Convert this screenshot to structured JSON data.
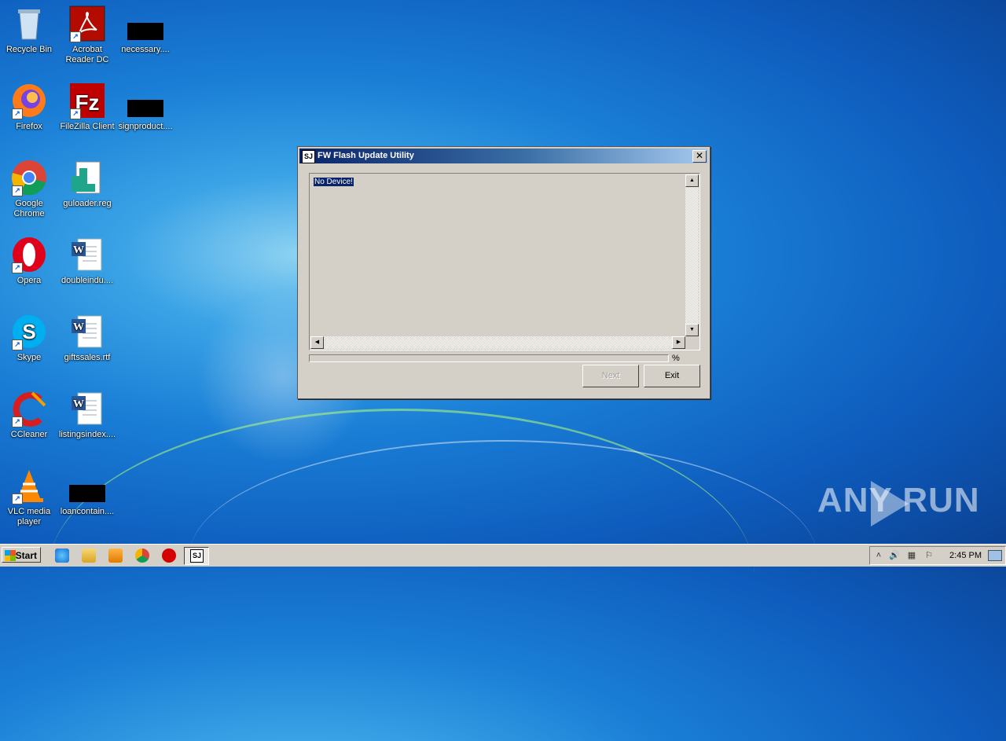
{
  "desktop": {
    "icons": [
      {
        "label": "Recycle Bin"
      },
      {
        "label": "Acrobat Reader DC"
      },
      {
        "label": "necessary...."
      },
      {
        "label": "Firefox"
      },
      {
        "label": "FileZilla Client"
      },
      {
        "label": "signproduct...."
      },
      {
        "label": "Google Chrome"
      },
      {
        "label": "guloader.reg"
      },
      {
        "label": "Opera"
      },
      {
        "label": "doubleindu...."
      },
      {
        "label": "Skype"
      },
      {
        "label": "giftssales.rtf"
      },
      {
        "label": "CCleaner"
      },
      {
        "label": "listingsindex...."
      },
      {
        "label": "VLC media player"
      },
      {
        "label": "loancontain...."
      }
    ]
  },
  "dialog": {
    "title": "FW Flash Update Utility",
    "icon_text": "SJ",
    "log_text": "No Device!",
    "percent_label": "%",
    "progress": 0,
    "next_label": "Next",
    "exit_label": "Exit",
    "close_glyph": "✕"
  },
  "taskbar": {
    "start_label": "Start",
    "clock": "2:45 PM",
    "active_app_icon": "SJ"
  },
  "watermark": {
    "text": "ANY  RUN"
  },
  "colors": {
    "title_start": "#0a246a",
    "title_end": "#a6caf0",
    "face": "#d4d0c8"
  }
}
